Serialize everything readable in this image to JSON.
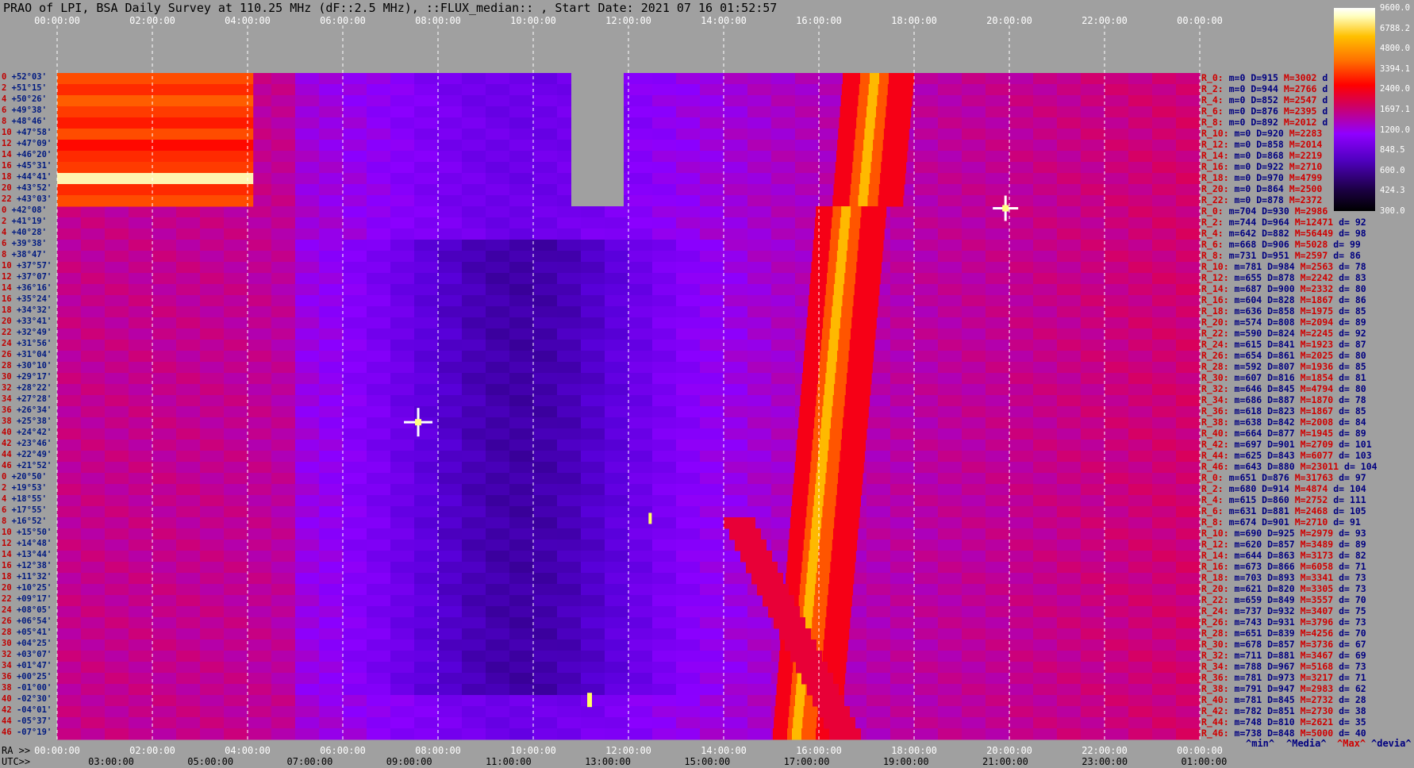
{
  "title": "PRAO of LPI, BSA Daily Survey at 110.25 MHz (dF::2.5 MHz), ::FLUX_median:: , Start Date: 2021 07 16 01:52:57",
  "chart_data": {
    "type": "heatmap",
    "top_axis_ticks": [
      "00:00:00",
      "02:00:00",
      "04:00:00",
      "06:00:00",
      "08:00:00",
      "10:00:00",
      "12:00:00",
      "14:00:00",
      "16:00:00",
      "18:00:00",
      "20:00:00",
      "22:00:00",
      "00:00:00"
    ],
    "bottom_ra_ticks": [
      "00:00:00",
      "02:00:00",
      "04:00:00",
      "06:00:00",
      "08:00:00",
      "10:00:00",
      "12:00:00",
      "14:00:00",
      "16:00:00",
      "18:00:00",
      "20:00:00",
      "22:00:00",
      "00:00:00"
    ],
    "bottom_utc_ticks": [
      "03:00:00",
      "05:00:00",
      "07:00:00",
      "09:00:00",
      "11:00:00",
      "13:00:00",
      "15:00:00",
      "17:00:00",
      "19:00:00",
      "21:00:00",
      "23:00:00",
      "01:00:00"
    ],
    "ra_label": "RA >>",
    "utc_label": "UTC>>",
    "colorbar": {
      "ticks": [
        "9600.0",
        "6788.2",
        "4800.0",
        "3394.1",
        "2400.0",
        "1697.1",
        "1200.0",
        "848.5",
        "600.0",
        "424.3",
        "300.0"
      ]
    },
    "declinations": [
      "+52°03'",
      "+51°15'",
      "+50°26'",
      "+49°38'",
      "+48°46'",
      "+47°58'",
      "+47°09'",
      "+46°20'",
      "+45°31'",
      "+44°41'",
      "+43°52'",
      "+43°03'",
      "+42°08'",
      "+41°19'",
      "+40°28'",
      "+39°38'",
      "+38°47'",
      "+37°57'",
      "+37°07'",
      "+36°16'",
      "+35°24'",
      "+34°32'",
      "+33°41'",
      "+32°49'",
      "+31°56'",
      "+31°04'",
      "+30°10'",
      "+29°17'",
      "+28°22'",
      "+27°28'",
      "+26°34'",
      "+25°38'",
      "+24°42'",
      "+23°46'",
      "+22°49'",
      "+21°52'",
      "+20°50'",
      "+19°53'",
      "+18°55'",
      "+17°55'",
      "+16°52'",
      "+15°50'",
      "+14°48'",
      "+13°44'",
      "+12°38'",
      "+11°32'",
      "+10°25'",
      "+09°17'",
      "+08°05'",
      "+06°54'",
      "+05°41'",
      "+04°25'",
      "+03°07'",
      "+01°47'",
      "+00°25'",
      "-01°00'",
      "-02°30'",
      "-04°01'",
      "-05°37'",
      "-07°19'"
    ],
    "dec_index": [
      "0",
      "2",
      "4",
      "6",
      "8",
      "10",
      "12",
      "14",
      "16",
      "18",
      "20",
      "22",
      "0",
      "2",
      "4",
      "6",
      "8",
      "10",
      "12",
      "14",
      "16",
      "18",
      "20",
      "22",
      "24",
      "26",
      "28",
      "30",
      "32",
      "34",
      "36",
      "38",
      "40",
      "42",
      "44",
      "46",
      "0",
      "2",
      "4",
      "6",
      "8",
      "10",
      "12",
      "14",
      "16",
      "18",
      "20",
      "22",
      "24",
      "26",
      "28",
      "30",
      "32",
      "34",
      "36",
      "38",
      "40",
      "42",
      "44",
      "46"
    ],
    "stats": [
      {
        "r": "R_0:",
        "m": "m=0",
        "d": "D=915",
        "x": "M=3002",
        "dv": "d"
      },
      {
        "r": "R_2:",
        "m": "m=0",
        "d": "D=944",
        "x": "M=2766",
        "dv": "d"
      },
      {
        "r": "R_4:",
        "m": "m=0",
        "d": "D=852",
        "x": "M=2547",
        "dv": "d"
      },
      {
        "r": "R_6:",
        "m": "m=0",
        "d": "D=876",
        "x": "M=2395",
        "dv": "d"
      },
      {
        "r": "R_8:",
        "m": "m=0",
        "d": "D=892",
        "x": "M=2012",
        "dv": "d"
      },
      {
        "r": "R_10:",
        "m": "m=0",
        "d": "D=920",
        "x": "M=2283",
        "dv": ""
      },
      {
        "r": "R_12:",
        "m": "m=0",
        "d": "D=858",
        "x": "M=2014",
        "dv": ""
      },
      {
        "r": "R_14:",
        "m": "m=0",
        "d": "D=868",
        "x": "M=2219",
        "dv": ""
      },
      {
        "r": "R_16:",
        "m": "m=0",
        "d": "D=922",
        "x": "M=2710",
        "dv": ""
      },
      {
        "r": "R_18:",
        "m": "m=0",
        "d": "D=970",
        "x": "M=4799",
        "dv": ""
      },
      {
        "r": "R_20:",
        "m": "m=0",
        "d": "D=864",
        "x": "M=2500",
        "dv": ""
      },
      {
        "r": "R_22:",
        "m": "m=0",
        "d": "D=878",
        "x": "M=2372",
        "dv": ""
      },
      {
        "r": "R_0:",
        "m": "m=704",
        "d": "D=930",
        "x": "M=2986",
        "dv": ""
      },
      {
        "r": "R_2:",
        "m": "m=744",
        "d": "D=964",
        "x": "M=12471",
        "dv": "d= 92"
      },
      {
        "r": "R_4:",
        "m": "m=642",
        "d": "D=882",
        "x": "M=56449",
        "dv": "d= 98"
      },
      {
        "r": "R_6:",
        "m": "m=668",
        "d": "D=906",
        "x": "M=5028",
        "dv": "d= 99"
      },
      {
        "r": "R_8:",
        "m": "m=731",
        "d": "D=951",
        "x": "M=2597",
        "dv": "d= 86"
      },
      {
        "r": "R_10:",
        "m": "m=781",
        "d": "D=984",
        "x": "M=2563",
        "dv": "d= 78"
      },
      {
        "r": "R_12:",
        "m": "m=655",
        "d": "D=878",
        "x": "M=2242",
        "dv": "d= 83"
      },
      {
        "r": "R_14:",
        "m": "m=687",
        "d": "D=900",
        "x": "M=2332",
        "dv": "d= 80"
      },
      {
        "r": "R_16:",
        "m": "m=604",
        "d": "D=828",
        "x": "M=1867",
        "dv": "d= 86"
      },
      {
        "r": "R_18:",
        "m": "m=636",
        "d": "D=858",
        "x": "M=1975",
        "dv": "d= 85"
      },
      {
        "r": "R_20:",
        "m": "m=574",
        "d": "D=808",
        "x": "M=2094",
        "dv": "d= 89"
      },
      {
        "r": "R_22:",
        "m": "m=590",
        "d": "D=824",
        "x": "M=2245",
        "dv": "d= 92"
      },
      {
        "r": "R_24:",
        "m": "m=615",
        "d": "D=841",
        "x": "M=1923",
        "dv": "d= 87"
      },
      {
        "r": "R_26:",
        "m": "m=654",
        "d": "D=861",
        "x": "M=2025",
        "dv": "d= 80"
      },
      {
        "r": "R_28:",
        "m": "m=592",
        "d": "D=807",
        "x": "M=1936",
        "dv": "d= 85"
      },
      {
        "r": "R_30:",
        "m": "m=607",
        "d": "D=816",
        "x": "M=1854",
        "dv": "d= 81"
      },
      {
        "r": "R_32:",
        "m": "m=646",
        "d": "D=845",
        "x": "M=4794",
        "dv": "d= 80"
      },
      {
        "r": "R_34:",
        "m": "m=686",
        "d": "D=887",
        "x": "M=1870",
        "dv": "d= 78"
      },
      {
        "r": "R_36:",
        "m": "m=618",
        "d": "D=823",
        "x": "M=1867",
        "dv": "d= 85"
      },
      {
        "r": "R_38:",
        "m": "m=638",
        "d": "D=842",
        "x": "M=2008",
        "dv": "d= 84"
      },
      {
        "r": "R_40:",
        "m": "m=664",
        "d": "D=877",
        "x": "M=1945",
        "dv": "d= 89"
      },
      {
        "r": "R_42:",
        "m": "m=697",
        "d": "D=901",
        "x": "M=2709",
        "dv": "d= 101"
      },
      {
        "r": "R_44:",
        "m": "m=625",
        "d": "D=843",
        "x": "M=6077",
        "dv": "d= 103"
      },
      {
        "r": "R_46:",
        "m": "m=643",
        "d": "D=880",
        "x": "M=23011",
        "dv": "d= 104"
      },
      {
        "r": "R_0:",
        "m": "m=651",
        "d": "D=876",
        "x": "M=31763",
        "dv": "d= 97"
      },
      {
        "r": "R_2:",
        "m": "m=680",
        "d": "D=914",
        "x": "M=4874",
        "dv": "d= 104"
      },
      {
        "r": "R_4:",
        "m": "m=615",
        "d": "D=860",
        "x": "M=2752",
        "dv": "d= 111"
      },
      {
        "r": "R_6:",
        "m": "m=631",
        "d": "D=881",
        "x": "M=2468",
        "dv": "d= 105"
      },
      {
        "r": "R_8:",
        "m": "m=674",
        "d": "D=901",
        "x": "M=2710",
        "dv": "d= 91"
      },
      {
        "r": "R_10:",
        "m": "m=690",
        "d": "D=925",
        "x": "M=2979",
        "dv": "d= 93"
      },
      {
        "r": "R_12:",
        "m": "m=620",
        "d": "D=857",
        "x": "M=3489",
        "dv": "d= 89"
      },
      {
        "r": "R_14:",
        "m": "m=644",
        "d": "D=863",
        "x": "M=3173",
        "dv": "d= 82"
      },
      {
        "r": "R_16:",
        "m": "m=673",
        "d": "D=866",
        "x": "M=6058",
        "dv": "d= 71"
      },
      {
        "r": "R_18:",
        "m": "m=703",
        "d": "D=893",
        "x": "M=3341",
        "dv": "d= 73"
      },
      {
        "r": "R_20:",
        "m": "m=621",
        "d": "D=820",
        "x": "M=3305",
        "dv": "d= 73"
      },
      {
        "r": "R_22:",
        "m": "m=659",
        "d": "D=849",
        "x": "M=3557",
        "dv": "d= 70"
      },
      {
        "r": "R_24:",
        "m": "m=737",
        "d": "D=932",
        "x": "M=3407",
        "dv": "d= 75"
      },
      {
        "r": "R_26:",
        "m": "m=743",
        "d": "D=931",
        "x": "M=3796",
        "dv": "d= 73"
      },
      {
        "r": "R_28:",
        "m": "m=651",
        "d": "D=839",
        "x": "M=4256",
        "dv": "d= 70"
      },
      {
        "r": "R_30:",
        "m": "m=678",
        "d": "D=857",
        "x": "M=3736",
        "dv": "d= 67"
      },
      {
        "r": "R_32:",
        "m": "m=711",
        "d": "D=881",
        "x": "M=3467",
        "dv": "d= 69"
      },
      {
        "r": "R_34:",
        "m": "m=788",
        "d": "D=967",
        "x": "M=5168",
        "dv": "d= 73"
      },
      {
        "r": "R_36:",
        "m": "m=781",
        "d": "D=973",
        "x": "M=3217",
        "dv": "d= 71"
      },
      {
        "r": "R_38:",
        "m": "m=791",
        "d": "D=947",
        "x": "M=2983",
        "dv": "d= 62"
      },
      {
        "r": "R_40:",
        "m": "m=781",
        "d": "D=845",
        "x": "M=2732",
        "dv": "d= 28"
      },
      {
        "r": "R_42:",
        "m": "m=782",
        "d": "D=851",
        "x": "M=2730",
        "dv": "d= 38"
      },
      {
        "r": "R_44:",
        "m": "m=748",
        "d": "D=810",
        "x": "M=2621",
        "dv": "d= 35"
      },
      {
        "r": "R_46:",
        "m": "m=738",
        "d": "D=848",
        "x": "M=5000",
        "dv": "d= 40"
      }
    ],
    "footer": [
      "^min^",
      "^Media^",
      "^Max^",
      "^devia^"
    ],
    "color_scale": {
      "low": "#000000",
      "mid_low": "#5000c0",
      "mid": "#9000ff",
      "mid_high": "#ff0000",
      "high": "#ffc000",
      "max": "#ffffff"
    }
  }
}
